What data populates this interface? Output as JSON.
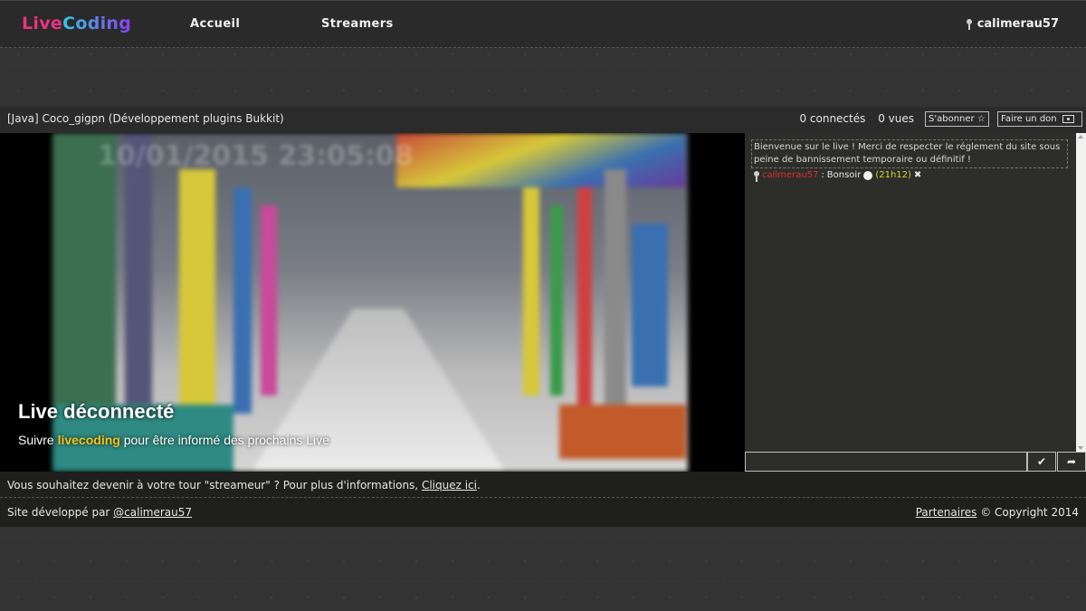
{
  "header": {
    "logo_part1": "Live",
    "logo_part2": "Coding",
    "nav": [
      "Accueil",
      "Streamers"
    ],
    "username": "calimerau57"
  },
  "stream": {
    "title": "[Java] Coco_gigpn (Développement plugins Bukkit)",
    "connected": "0 connectés",
    "views": "0 vues",
    "subscribe_label": "S'abonner ☆",
    "donate_label": "Faire un don",
    "frame_timestamp": "10/01/2015 23:05:08"
  },
  "offline": {
    "title": "Live déconnecté",
    "sub_before": "Suivre ",
    "sub_highlight": "livecoding",
    "sub_after": " pour être informé des prochains Live"
  },
  "chat": {
    "welcome": "Bienvenue sur le live ! Merci de respecter le réglement du site sous peine de bannissement temporaire ou définitif !",
    "messages": [
      {
        "user": "calimerau57",
        "text": "Bonsoir",
        "time": "(21h12)",
        "delete": "✖"
      }
    ],
    "input_value": "",
    "send_icon": "✔",
    "exit_icon": "➦"
  },
  "promo": {
    "text": "Vous souhaitez devenir à votre tour \"streameur\" ? Pour plus d'informations, ",
    "link": "Cliquez ici",
    "end": "."
  },
  "footer": {
    "left_text": "Site développé par ",
    "left_link": "@calimerau57",
    "right_link": "Partenaires",
    "right_text": " © Copyright 2014"
  },
  "colors": {
    "accent_pink": "#e8337f",
    "accent_blue": "#33c6e8",
    "highlight_yellow": "#f5c518",
    "chat_user_red": "#e0312e"
  }
}
